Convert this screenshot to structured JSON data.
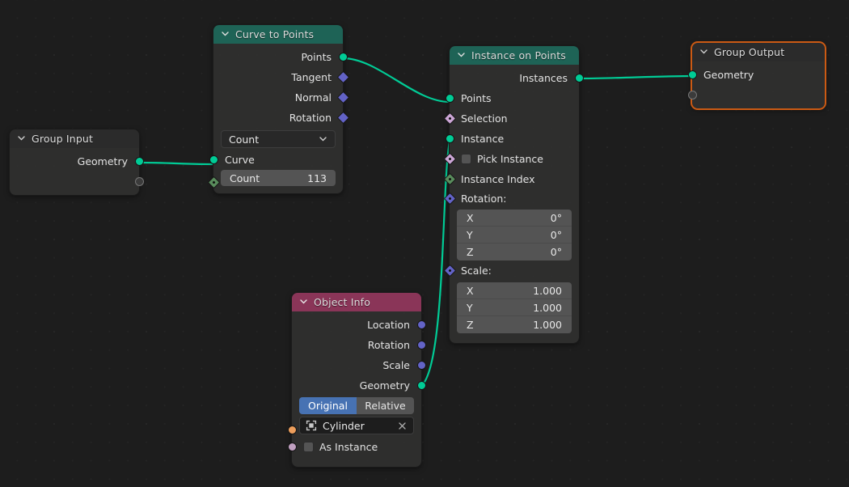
{
  "editor": {
    "name": "geometry-node-editor",
    "background": "#1d1d1d",
    "accent_selected": "#cb5a14"
  },
  "colors": {
    "header_geometry": "#1e6356",
    "header_object": "#8a3558",
    "header_input": "#2b2b2b",
    "socket_geometry": "#00cc96",
    "socket_vector": "#6363c7",
    "socket_boolean": "#cca6d6",
    "socket_int": "#598c5c",
    "socket_object": "#ed9e5c",
    "socket_collection": "#c0a0c0",
    "link": "#00cc96",
    "button_active": "#4772b3"
  },
  "nodes": [
    {
      "id": "group-input",
      "title": "Group Input",
      "header_style": "input",
      "selected": false,
      "outputs": [
        {
          "label": "Geometry",
          "socket": "geometry"
        },
        {
          "label": "",
          "socket": "hollow"
        }
      ]
    },
    {
      "id": "curve-to-points",
      "title": "Curve to Points",
      "header_style": "geometry",
      "selected": false,
      "outputs": [
        {
          "label": "Points",
          "socket": "geometry"
        },
        {
          "label": "Tangent",
          "socket": "vector"
        },
        {
          "label": "Normal",
          "socket": "vector"
        },
        {
          "label": "Rotation",
          "socket": "vector"
        }
      ],
      "dropdown": {
        "label": "Count",
        "icon": "chevron-down-icon"
      },
      "inputs": [
        {
          "label": "Curve",
          "socket": "geometry"
        }
      ],
      "number_field": {
        "label": "Count",
        "value": "113",
        "socket": "int"
      }
    },
    {
      "id": "instance-on-points",
      "title": "Instance on Points",
      "header_style": "geometry",
      "selected": false,
      "outputs": [
        {
          "label": "Instances",
          "socket": "geometry"
        }
      ],
      "inputs": [
        {
          "label": "Points",
          "socket": "geometry",
          "type": "label"
        },
        {
          "label": "Selection",
          "socket": "boolean",
          "type": "label"
        },
        {
          "label": "Instance",
          "socket": "geometry",
          "type": "label"
        },
        {
          "label": "Pick Instance",
          "socket": "boolean",
          "type": "checkbox",
          "checked": false
        },
        {
          "label": "Instance Index",
          "socket": "int",
          "type": "label"
        },
        {
          "label": "Rotation:",
          "socket": "vector",
          "type": "vector"
        },
        {
          "label": "Scale:",
          "socket": "vector",
          "type": "vector"
        }
      ],
      "rotation": {
        "label": "Rotation:",
        "x": "0°",
        "y": "0°",
        "z": "0°",
        "axes": [
          "X",
          "Y",
          "Z"
        ]
      },
      "scale": {
        "label": "Scale:",
        "x": "1.000",
        "y": "1.000",
        "z": "1.000",
        "axes": [
          "X",
          "Y",
          "Z"
        ]
      }
    },
    {
      "id": "object-info",
      "title": "Object Info",
      "header_style": "object",
      "selected": false,
      "outputs": [
        {
          "label": "Location",
          "socket": "vector"
        },
        {
          "label": "Rotation",
          "socket": "vector"
        },
        {
          "label": "Scale",
          "socket": "vector"
        },
        {
          "label": "Geometry",
          "socket": "geometry"
        }
      ],
      "transform_space": {
        "options": [
          "Original",
          "Relative"
        ],
        "selected": "Original"
      },
      "object_field": {
        "value": "Cylinder",
        "icon": "object-icon",
        "clear_icon": "close-icon",
        "socket": "object"
      },
      "as_instance": {
        "label": "As Instance",
        "checked": false,
        "socket": "collection"
      }
    },
    {
      "id": "group-output",
      "title": "Group Output",
      "header_style": "input",
      "selected": true,
      "inputs": [
        {
          "label": "Geometry",
          "socket": "geometry"
        },
        {
          "label": "",
          "socket": "hollow"
        }
      ]
    }
  ]
}
